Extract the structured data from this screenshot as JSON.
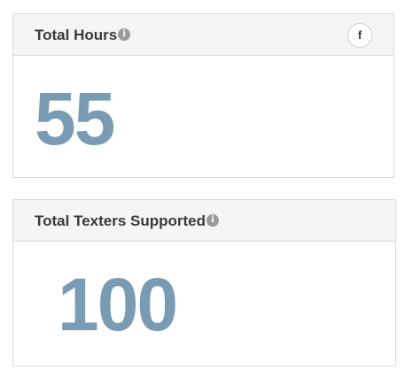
{
  "cards": [
    {
      "title": "Total Hours",
      "value": "55",
      "info_icon": "info-icon",
      "share_icon": "facebook-icon",
      "share_label": "f"
    },
    {
      "title": "Total Texters Supported",
      "value": "100",
      "info_icon": "info-icon"
    }
  ],
  "info_glyph": "i",
  "colors": {
    "value": "#7a9bb4",
    "header_bg": "#f5f5f5",
    "border": "#dadada",
    "title": "#3a3a3a"
  }
}
